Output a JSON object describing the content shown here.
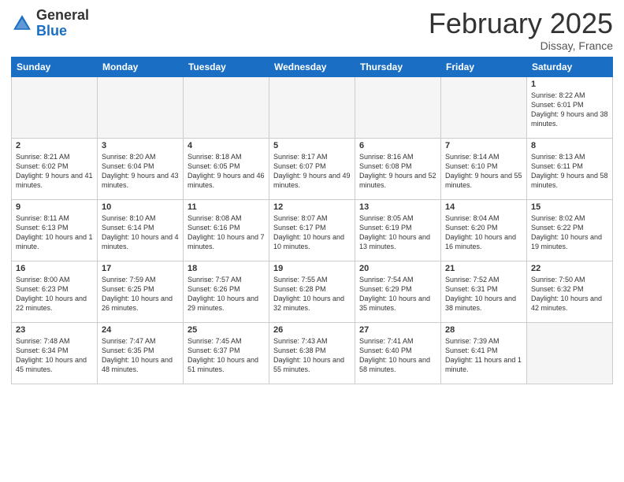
{
  "header": {
    "logo_general": "General",
    "logo_blue": "Blue",
    "month_title": "February 2025",
    "subtitle": "Dissay, France"
  },
  "days_of_week": [
    "Sunday",
    "Monday",
    "Tuesday",
    "Wednesday",
    "Thursday",
    "Friday",
    "Saturday"
  ],
  "weeks": [
    [
      {
        "num": "",
        "info": ""
      },
      {
        "num": "",
        "info": ""
      },
      {
        "num": "",
        "info": ""
      },
      {
        "num": "",
        "info": ""
      },
      {
        "num": "",
        "info": ""
      },
      {
        "num": "",
        "info": ""
      },
      {
        "num": "1",
        "info": "Sunrise: 8:22 AM\nSunset: 6:01 PM\nDaylight: 9 hours and 38 minutes."
      }
    ],
    [
      {
        "num": "2",
        "info": "Sunrise: 8:21 AM\nSunset: 6:02 PM\nDaylight: 9 hours and 41 minutes."
      },
      {
        "num": "3",
        "info": "Sunrise: 8:20 AM\nSunset: 6:04 PM\nDaylight: 9 hours and 43 minutes."
      },
      {
        "num": "4",
        "info": "Sunrise: 8:18 AM\nSunset: 6:05 PM\nDaylight: 9 hours and 46 minutes."
      },
      {
        "num": "5",
        "info": "Sunrise: 8:17 AM\nSunset: 6:07 PM\nDaylight: 9 hours and 49 minutes."
      },
      {
        "num": "6",
        "info": "Sunrise: 8:16 AM\nSunset: 6:08 PM\nDaylight: 9 hours and 52 minutes."
      },
      {
        "num": "7",
        "info": "Sunrise: 8:14 AM\nSunset: 6:10 PM\nDaylight: 9 hours and 55 minutes."
      },
      {
        "num": "8",
        "info": "Sunrise: 8:13 AM\nSunset: 6:11 PM\nDaylight: 9 hours and 58 minutes."
      }
    ],
    [
      {
        "num": "9",
        "info": "Sunrise: 8:11 AM\nSunset: 6:13 PM\nDaylight: 10 hours and 1 minute."
      },
      {
        "num": "10",
        "info": "Sunrise: 8:10 AM\nSunset: 6:14 PM\nDaylight: 10 hours and 4 minutes."
      },
      {
        "num": "11",
        "info": "Sunrise: 8:08 AM\nSunset: 6:16 PM\nDaylight: 10 hours and 7 minutes."
      },
      {
        "num": "12",
        "info": "Sunrise: 8:07 AM\nSunset: 6:17 PM\nDaylight: 10 hours and 10 minutes."
      },
      {
        "num": "13",
        "info": "Sunrise: 8:05 AM\nSunset: 6:19 PM\nDaylight: 10 hours and 13 minutes."
      },
      {
        "num": "14",
        "info": "Sunrise: 8:04 AM\nSunset: 6:20 PM\nDaylight: 10 hours and 16 minutes."
      },
      {
        "num": "15",
        "info": "Sunrise: 8:02 AM\nSunset: 6:22 PM\nDaylight: 10 hours and 19 minutes."
      }
    ],
    [
      {
        "num": "16",
        "info": "Sunrise: 8:00 AM\nSunset: 6:23 PM\nDaylight: 10 hours and 22 minutes."
      },
      {
        "num": "17",
        "info": "Sunrise: 7:59 AM\nSunset: 6:25 PM\nDaylight: 10 hours and 26 minutes."
      },
      {
        "num": "18",
        "info": "Sunrise: 7:57 AM\nSunset: 6:26 PM\nDaylight: 10 hours and 29 minutes."
      },
      {
        "num": "19",
        "info": "Sunrise: 7:55 AM\nSunset: 6:28 PM\nDaylight: 10 hours and 32 minutes."
      },
      {
        "num": "20",
        "info": "Sunrise: 7:54 AM\nSunset: 6:29 PM\nDaylight: 10 hours and 35 minutes."
      },
      {
        "num": "21",
        "info": "Sunrise: 7:52 AM\nSunset: 6:31 PM\nDaylight: 10 hours and 38 minutes."
      },
      {
        "num": "22",
        "info": "Sunrise: 7:50 AM\nSunset: 6:32 PM\nDaylight: 10 hours and 42 minutes."
      }
    ],
    [
      {
        "num": "23",
        "info": "Sunrise: 7:48 AM\nSunset: 6:34 PM\nDaylight: 10 hours and 45 minutes."
      },
      {
        "num": "24",
        "info": "Sunrise: 7:47 AM\nSunset: 6:35 PM\nDaylight: 10 hours and 48 minutes."
      },
      {
        "num": "25",
        "info": "Sunrise: 7:45 AM\nSunset: 6:37 PM\nDaylight: 10 hours and 51 minutes."
      },
      {
        "num": "26",
        "info": "Sunrise: 7:43 AM\nSunset: 6:38 PM\nDaylight: 10 hours and 55 minutes."
      },
      {
        "num": "27",
        "info": "Sunrise: 7:41 AM\nSunset: 6:40 PM\nDaylight: 10 hours and 58 minutes."
      },
      {
        "num": "28",
        "info": "Sunrise: 7:39 AM\nSunset: 6:41 PM\nDaylight: 11 hours and 1 minute."
      },
      {
        "num": "",
        "info": ""
      }
    ]
  ]
}
